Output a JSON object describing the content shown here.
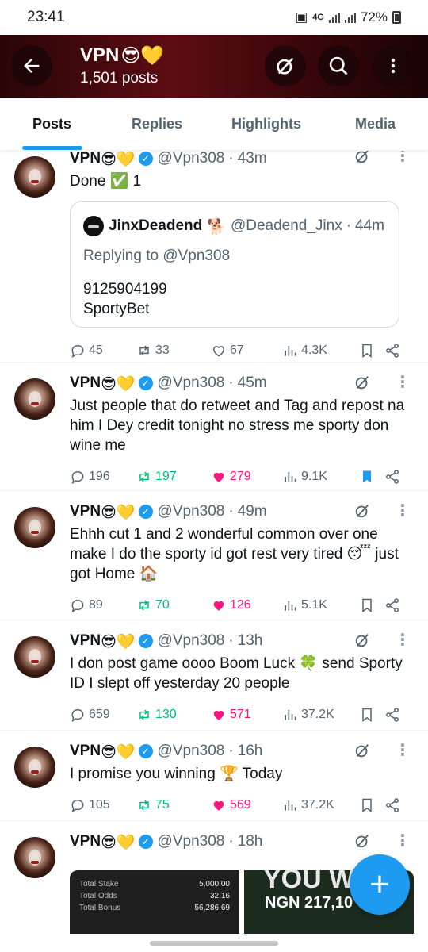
{
  "status": {
    "time": "23:41",
    "network": "4G",
    "battery": "72%"
  },
  "header": {
    "name": "VPN",
    "name_emoji": "😎💛",
    "post_count": "1,501 posts"
  },
  "tabs": [
    "Posts",
    "Replies",
    "Highlights",
    "Media"
  ],
  "colors": {
    "accent": "#1d9bf0",
    "like": "#f91880",
    "retweet": "#00ba7c",
    "header_bg": "#4a0a10"
  },
  "posts": [
    {
      "name": "VPN",
      "emoji": "😎💛",
      "handle": "@Vpn308",
      "time": "43m",
      "text": "Done ✅ 1",
      "quote": {
        "name": "JinxDeadend",
        "emoji": "🐕",
        "handle": "@Deadend_Jinx",
        "time": "44m",
        "reply": "Replying to @Vpn308",
        "text1": "9125904199",
        "text2": "SportyBet"
      },
      "replies": "45",
      "retweets": "33",
      "likes": "67",
      "views": "4.3K",
      "liked": false,
      "retweeted": false,
      "bookmarked": false
    },
    {
      "name": "VPN",
      "emoji": "😎💛",
      "handle": "@Vpn308",
      "time": "45m",
      "text": "Just people that do retweet and Tag and repost na him I Dey credit tonight no stress me sporty don wine me",
      "replies": "196",
      "retweets": "197",
      "likes": "279",
      "views": "9.1K",
      "liked": true,
      "retweeted": true,
      "bookmarked": true
    },
    {
      "name": "VPN",
      "emoji": "😎💛",
      "handle": "@Vpn308",
      "time": "49m",
      "text": "Ehhh cut 1 and 2 wonderful common over one make I do the sporty id got rest very tired 😴 just got Home 🏠",
      "replies": "89",
      "retweets": "70",
      "likes": "126",
      "views": "5.1K",
      "liked": true,
      "retweeted": true,
      "bookmarked": false
    },
    {
      "name": "VPN",
      "emoji": "😎💛",
      "handle": "@Vpn308",
      "time": "13h",
      "text": "I don post game oooo Boom Luck 🍀 send Sporty ID I slept off yesterday 20 people",
      "replies": "659",
      "retweets": "130",
      "likes": "571",
      "views": "37.2K",
      "liked": true,
      "retweeted": true,
      "bookmarked": false
    },
    {
      "name": "VPN",
      "emoji": "😎💛",
      "handle": "@Vpn308",
      "time": "16h",
      "text": "I promise you winning 🏆 Today",
      "replies": "105",
      "retweets": "75",
      "likes": "569",
      "views": "37.2K",
      "liked": true,
      "retweeted": true,
      "bookmarked": false
    },
    {
      "name": "VPN",
      "emoji": "😎💛",
      "handle": "@Vpn308",
      "time": "18h",
      "media": {
        "slip": [
          {
            "label": "Total Stake",
            "value": "5,000.00"
          },
          {
            "label": "Total Odds",
            "value": "32.16"
          },
          {
            "label": "Total Bonus",
            "value": "56,286.69"
          }
        ],
        "banner_big": "YOU W",
        "banner_amount": "NGN 217,10"
      }
    }
  ],
  "fab": "+"
}
